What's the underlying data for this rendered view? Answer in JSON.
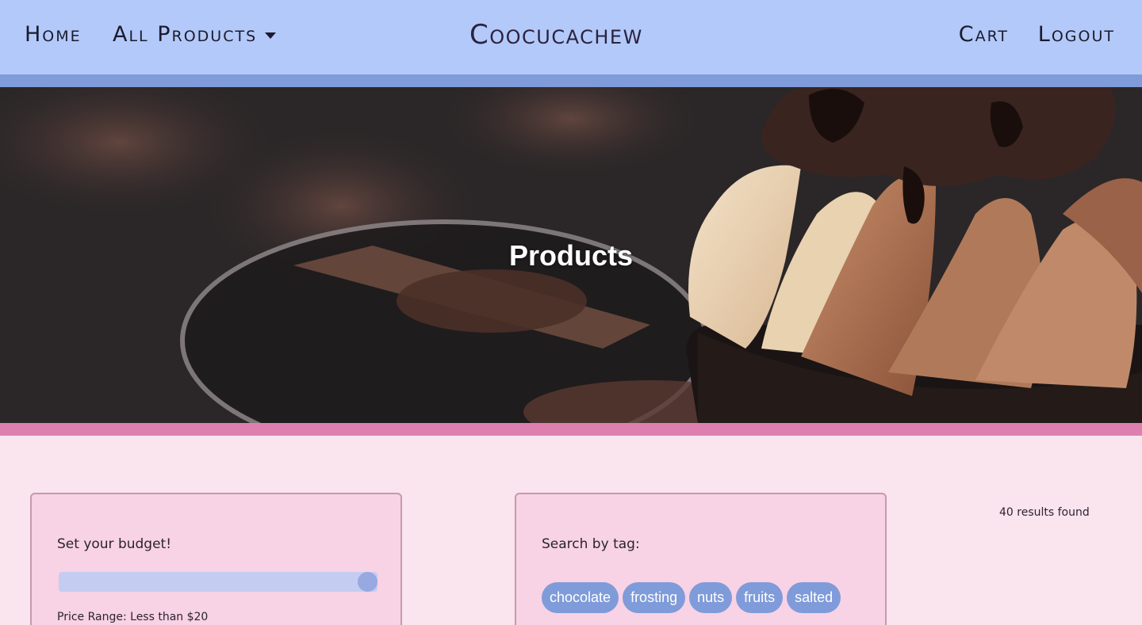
{
  "nav": {
    "home": "Home",
    "all_products": "All Products",
    "brand": "Coocucachew",
    "cart": "Cart",
    "logout": "Logout"
  },
  "hero": {
    "title": "Products"
  },
  "filters": {
    "budget": {
      "label": "Set your budget!",
      "slider_fraction": 0.97,
      "range_text": "Price Range: Less than $20"
    },
    "tags": {
      "label": "Search by tag:",
      "items": [
        "chocolate",
        "frosting",
        "nuts",
        "fruits",
        "salted"
      ]
    }
  },
  "results": {
    "count_text": "40 results found"
  },
  "colors": {
    "navbar": "#b3c9f9",
    "nav_border": "#7f9bd9",
    "hero_border": "#dd80b0",
    "page_bg": "#fae4ee",
    "panel_bg": "#f8d2e5",
    "tag_bg": "#7f9bd9"
  }
}
